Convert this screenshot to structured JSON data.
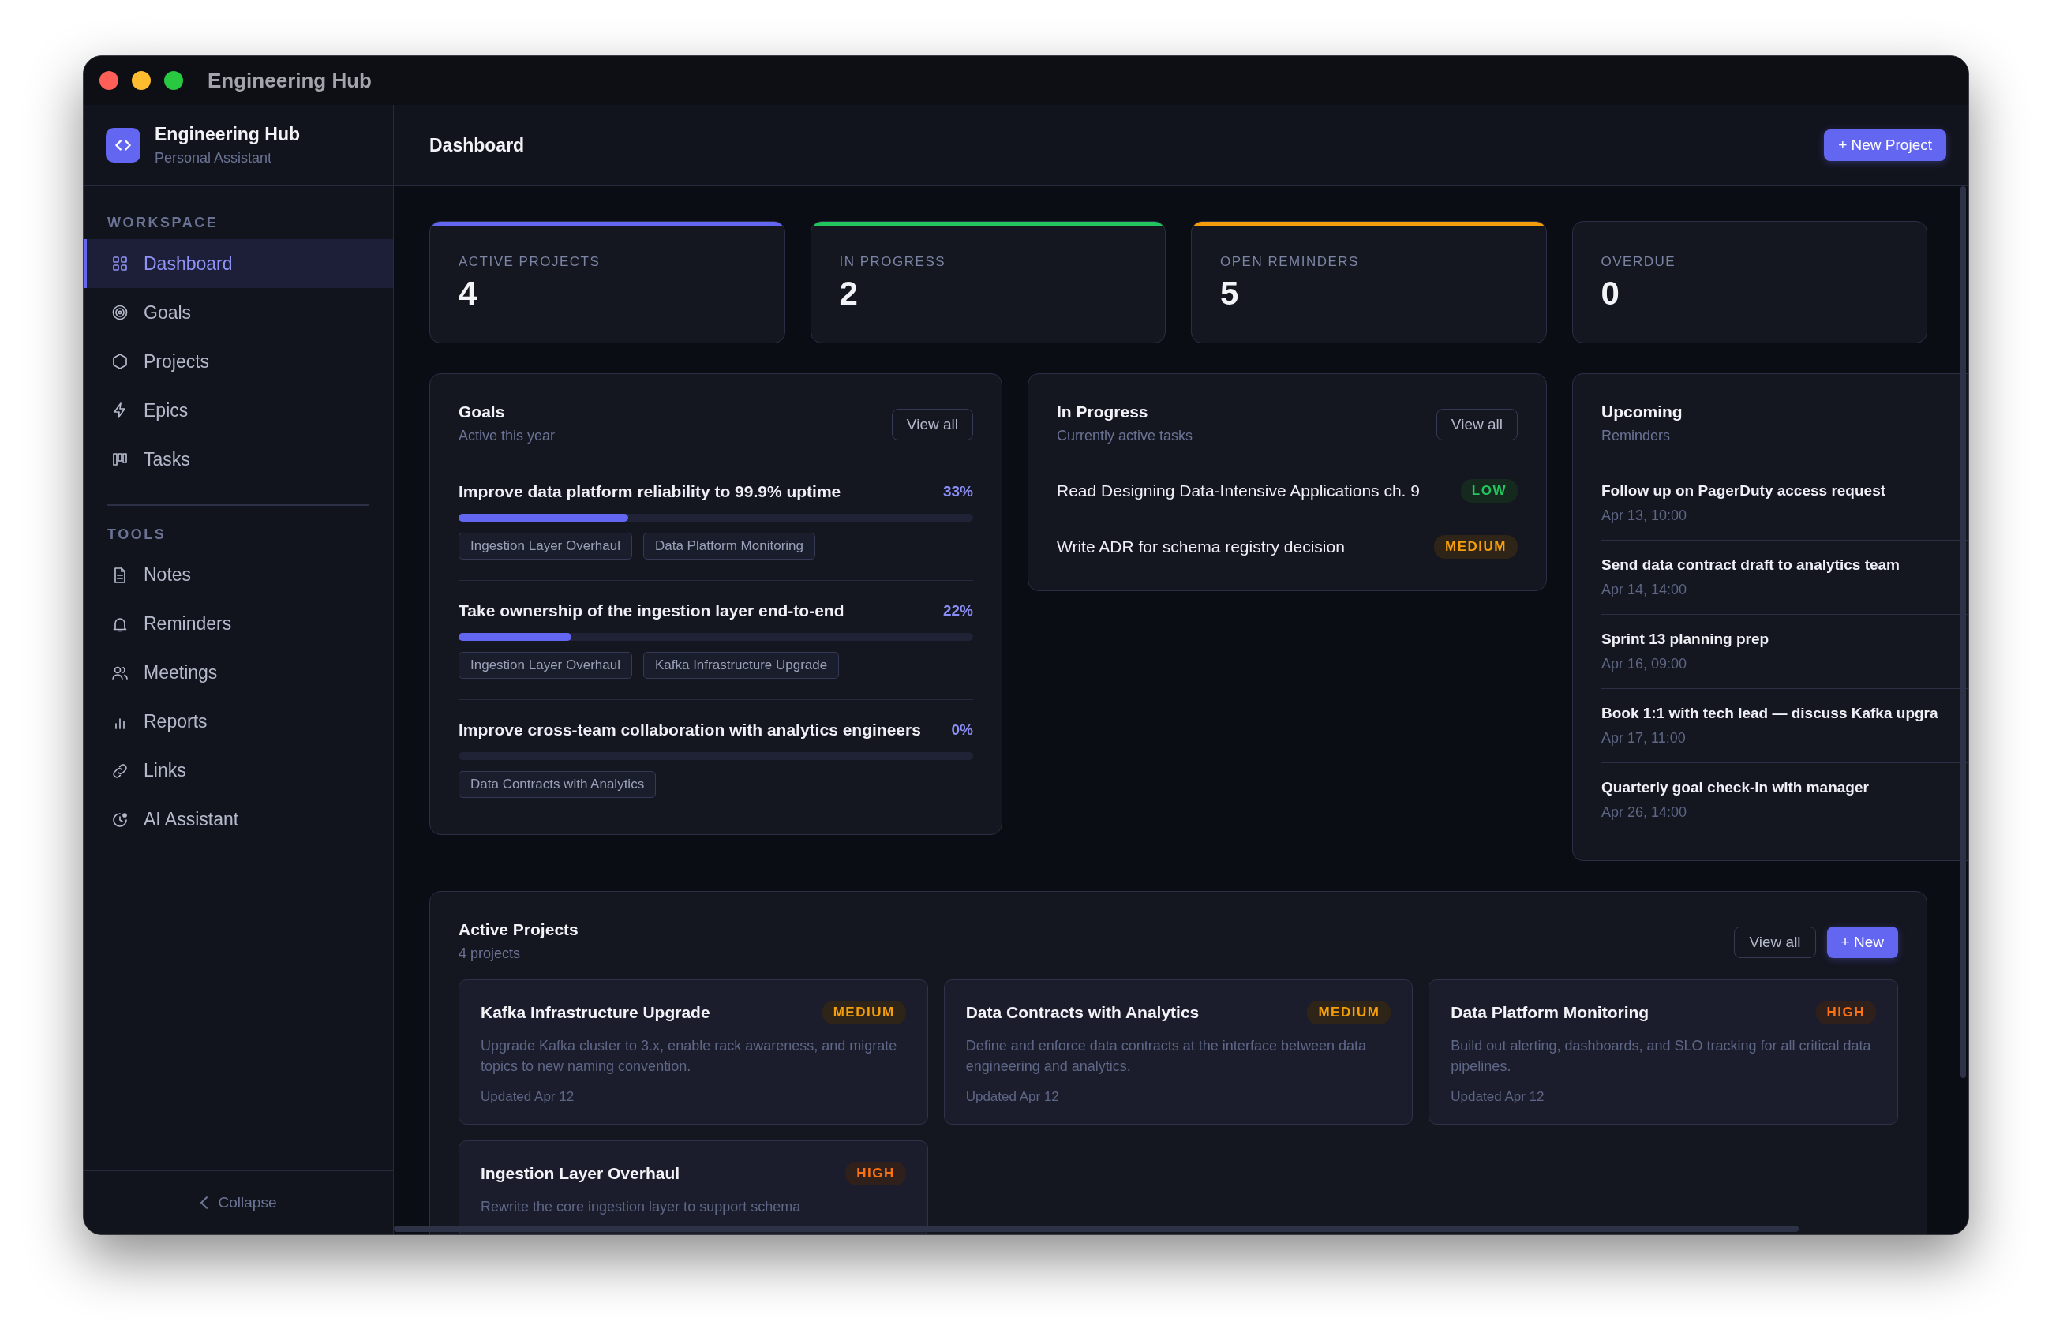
{
  "window": {
    "title": "Engineering Hub"
  },
  "sidebar": {
    "brand": {
      "title": "Engineering Hub",
      "subtitle": "Personal Assistant"
    },
    "sections": [
      {
        "heading": "WORKSPACE",
        "items": [
          {
            "label": "Dashboard",
            "selected": true
          },
          {
            "label": "Goals",
            "selected": false
          },
          {
            "label": "Projects",
            "selected": false
          },
          {
            "label": "Epics",
            "selected": false
          },
          {
            "label": "Tasks",
            "selected": false
          }
        ]
      },
      {
        "heading": "TOOLS",
        "items": [
          {
            "label": "Notes",
            "selected": false
          },
          {
            "label": "Reminders",
            "selected": false
          },
          {
            "label": "Meetings",
            "selected": false
          },
          {
            "label": "Reports",
            "selected": false
          },
          {
            "label": "Links",
            "selected": false
          },
          {
            "label": "AI Assistant",
            "selected": false
          }
        ]
      }
    ],
    "collapse": "Collapse"
  },
  "header": {
    "title": "Dashboard",
    "button": "+ New Project"
  },
  "stats": [
    {
      "label": "ACTIVE PROJECTS",
      "value": "4",
      "color": "#6366f1"
    },
    {
      "label": "IN PROGRESS",
      "value": "2",
      "color": "#22c55e"
    },
    {
      "label": "OPEN REMINDERS",
      "value": "5",
      "color": "#f59e0b"
    },
    {
      "label": "OVERDUE",
      "value": "0"
    }
  ],
  "goals": {
    "title": "Goals",
    "subtitle": "Active this year",
    "view_all": "View all",
    "items": [
      {
        "title": "Improve data platform reliability to 99.9% uptime",
        "percent": "33%",
        "level": 0.33,
        "tags": [
          "Ingestion Layer Overhaul",
          "Data Platform Monitoring"
        ]
      },
      {
        "title": "Take ownership of the ingestion layer end-to-end",
        "percent": "22%",
        "level": 0.22,
        "tags": [
          "Ingestion Layer Overhaul",
          "Kafka Infrastructure Upgrade"
        ]
      },
      {
        "title": "Improve cross-team collaboration with analytics engineers",
        "percent": "0%",
        "level": 0,
        "tags": [
          "Data Contracts with Analytics"
        ]
      }
    ]
  },
  "in_progress": {
    "title": "In Progress",
    "subtitle": "Currently active tasks",
    "view_all": "View all",
    "tasks": [
      {
        "title": "Read Designing Data-Intensive Applications ch. 9",
        "badge": "LOW",
        "kind": "low"
      },
      {
        "title": "Write ADR for schema registry decision",
        "badge": "MEDIUM",
        "kind": "medium"
      }
    ]
  },
  "upcoming": {
    "title": "Upcoming",
    "subtitle": "Reminders",
    "reminders": [
      {
        "title": "Follow up on PagerDuty access request",
        "time": "Apr 13, 10:00"
      },
      {
        "title": "Send data contract draft to analytics team",
        "time": "Apr 14, 14:00"
      },
      {
        "title": "Sprint 13 planning prep",
        "time": "Apr 16, 09:00"
      },
      {
        "title": "Book 1:1 with tech lead — discuss Kafka upgra",
        "time": "Apr 17, 11:00"
      },
      {
        "title": "Quarterly goal check-in with manager",
        "time": "Apr 26, 14:00"
      }
    ]
  },
  "projects": {
    "title": "Active Projects",
    "subtitle": "4 projects",
    "view_all": "View all",
    "new_button": "+ New",
    "items": [
      {
        "name": "Kafka Infrastructure Upgrade",
        "badge": "MEDIUM",
        "kind": "medium",
        "description": "Upgrade Kafka cluster to 3.x, enable rack awareness, and migrate topics to new naming convention.",
        "updated": "Updated Apr 12"
      },
      {
        "name": "Data Contracts with Analytics",
        "badge": "MEDIUM",
        "kind": "medium",
        "description": "Define and enforce data contracts at the interface between data engineering and analytics.",
        "updated": "Updated Apr 12"
      },
      {
        "name": "Data Platform Monitoring",
        "badge": "HIGH",
        "kind": "high",
        "description": "Build out alerting, dashboards, and SLO tracking for all critical data pipelines.",
        "updated": "Updated Apr 12"
      },
      {
        "name": "Ingestion Layer Overhaul",
        "badge": "HIGH",
        "kind": "high",
        "description": "Rewrite the core ingestion layer to support schema"
      }
    ]
  }
}
